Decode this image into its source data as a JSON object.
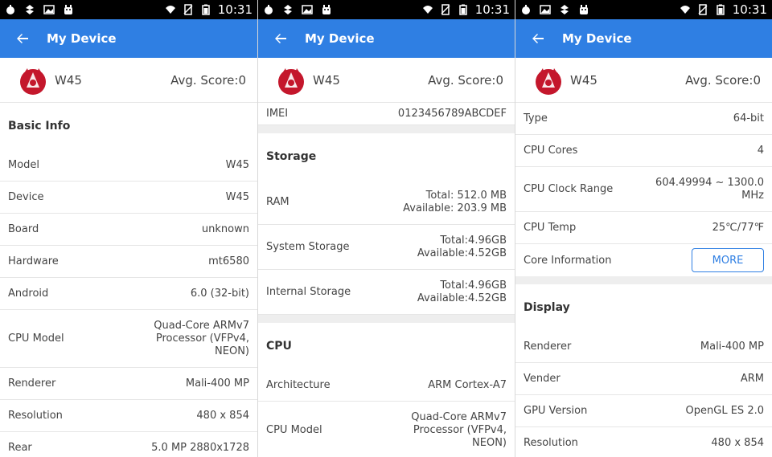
{
  "statusbar": {
    "time": "10:31"
  },
  "appbar": {
    "title": "My Device"
  },
  "device": {
    "name": "W45",
    "avg_score": "Avg. Score:0"
  },
  "panel1": {
    "section": "Basic Info",
    "rows": [
      {
        "label": "Model",
        "value": "W45"
      },
      {
        "label": "Device",
        "value": "W45"
      },
      {
        "label": "Board",
        "value": "unknown"
      },
      {
        "label": "Hardware",
        "value": "mt6580"
      },
      {
        "label": "Android",
        "value": "6.0 (32-bit)"
      },
      {
        "label": "CPU Model",
        "value": "Quad-Core ARMv7\nProcessor (VFPv4,\nNEON)"
      },
      {
        "label": "Renderer",
        "value": "Mali-400 MP"
      },
      {
        "label": "Resolution",
        "value": "480 x 854"
      },
      {
        "label": "Rear",
        "value": "5.0 MP 2880x1728"
      }
    ]
  },
  "panel2": {
    "imei": {
      "label": "IMEI",
      "value": "0123456789ABCDEF"
    },
    "storage_section": "Storage",
    "storage_rows": [
      {
        "label": "RAM",
        "value": "Total: 512.0 MB\nAvailable: 203.9 MB"
      },
      {
        "label": "System Storage",
        "value": "Total:4.96GB\nAvailable:4.52GB"
      },
      {
        "label": "Internal Storage",
        "value": "Total:4.96GB\nAvailable:4.52GB"
      }
    ],
    "cpu_section": "CPU",
    "cpu_rows": [
      {
        "label": "Architecture",
        "value": "ARM Cortex-A7"
      },
      {
        "label": "CPU Model",
        "value": "Quad-Core ARMv7\nProcessor (VFPv4,\nNEON)"
      }
    ]
  },
  "panel3": {
    "cpu_rows": [
      {
        "label": "Type",
        "value": "64-bit"
      },
      {
        "label": "CPU Cores",
        "value": "4"
      },
      {
        "label": "CPU Clock Range",
        "value": "604.49994 ~ 1300.0\nMHz"
      },
      {
        "label": "CPU Temp",
        "value": "25℃/77℉"
      }
    ],
    "core_info": {
      "label": "Core Information",
      "button": "MORE"
    },
    "display_section": "Display",
    "display_rows": [
      {
        "label": "Renderer",
        "value": "Mali-400 MP"
      },
      {
        "label": "Vender",
        "value": "ARM"
      },
      {
        "label": "GPU Version",
        "value": "OpenGL ES 2.0"
      },
      {
        "label": "Resolution",
        "value": "480 x 854"
      }
    ]
  },
  "colors": {
    "accent": "#2f7fe3",
    "separator": "#eeeeee"
  },
  "icons": [
    "notification-icon",
    "sync-icon",
    "image-icon",
    "android-icon",
    "wifi-icon",
    "no-sim-icon",
    "battery-icon",
    "back-arrow-icon",
    "antutu-logo"
  ]
}
